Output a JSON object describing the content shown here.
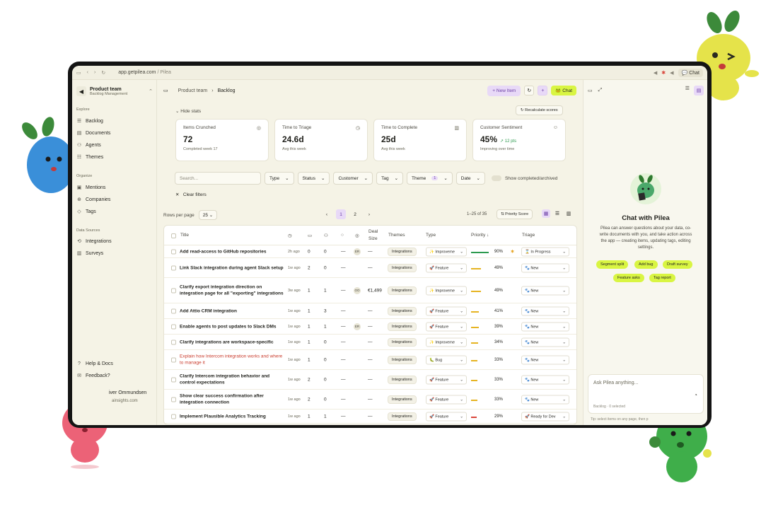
{
  "browser": {
    "url_domain": "app.getpilea.com",
    "url_suffix": " / Pilea",
    "chat_label": "Chat"
  },
  "sidebar": {
    "team_name": "Product team",
    "team_sub": "Backlog Management",
    "sections": {
      "explore": "Explore",
      "organize": "Organize",
      "data_sources": "Data Sources"
    },
    "explore_items": [
      {
        "label": "Backlog",
        "icon": "list-icon"
      },
      {
        "label": "Documents",
        "icon": "document-icon"
      },
      {
        "label": "Agents",
        "icon": "agent-icon"
      },
      {
        "label": "Themes",
        "icon": "themes-icon"
      }
    ],
    "organize_items": [
      {
        "label": "Mentions",
        "icon": "mentions-icon"
      },
      {
        "label": "Companies",
        "icon": "companies-icon"
      },
      {
        "label": "Tags",
        "icon": "tag-icon"
      }
    ],
    "data_items": [
      {
        "label": "Integrations",
        "icon": "integrations-icon"
      },
      {
        "label": "Surveys",
        "icon": "surveys-icon"
      }
    ],
    "help": "Help & Docs",
    "feedback": "Feedback?",
    "user_name": "iver Ommundsen",
    "user_email": "ainsights.com"
  },
  "topbar": {
    "crumb_root": "Product team",
    "crumb_sep": "›",
    "crumb_current": "Backlog",
    "new_item": "+ New Item",
    "chat": "Chat"
  },
  "stats_toggle": "Hide stats",
  "recalc": "Recalculate scores",
  "stats": [
    {
      "label": "Items Crunched",
      "value": "72",
      "sub": "Completed week 17",
      "icon": "target-icon"
    },
    {
      "label": "Time to Triage",
      "value": "24.6d",
      "sub": "Avg this week",
      "icon": "clock-icon"
    },
    {
      "label": "Time to Complete",
      "value": "25d",
      "sub": "Avg this week",
      "icon": "chart-icon"
    },
    {
      "label": "Customer Sentiment",
      "value": "45%",
      "delta": "↗ 12 pts",
      "sub": "Improving over time",
      "icon": "smile-icon"
    }
  ],
  "filters": {
    "search_placeholder": "Search...",
    "type": "Type",
    "status": "Status",
    "customer": "Customer",
    "tag": "Tag",
    "theme": "Theme",
    "theme_count": "1",
    "date": "Date",
    "show_completed": "Show completed/archived",
    "clear": "Clear filters"
  },
  "pagination": {
    "rows_label": "Rows per page",
    "rows_value": "25",
    "prev": "‹",
    "next": "›",
    "pages": [
      "1",
      "2"
    ],
    "range": "1–25 of 35",
    "sort": "Priority Score"
  },
  "table": {
    "headers": {
      "title": "Title",
      "deal": "Deal",
      "deal2": "Size",
      "themes": "Themes",
      "type": "Type",
      "priority": "Priority ↓",
      "triage": "Triage"
    },
    "rows": [
      {
        "title": "Add read-access to GitHub repositories",
        "red": false,
        "age": "2h ago",
        "c1": "0",
        "c2": "0",
        "c3": "—",
        "av": "ER",
        "deal": "—",
        "theme": "Integrations",
        "type": "✨ Improveme",
        "pct": 90,
        "pct_label": "90%",
        "color": "#2c9a4e",
        "triage": "⌛ In Progress",
        "star": true
      },
      {
        "title": "Link Slack integration during agent Slack setup",
        "red": false,
        "age": "1w ago",
        "c1": "2",
        "c2": "0",
        "c3": "—",
        "av": "",
        "deal": "—",
        "theme": "Integrations",
        "type": "🚀 Feature",
        "pct": 49,
        "pct_label": "49%",
        "color": "#e6b422",
        "triage": "🐾 New",
        "star": false
      },
      {
        "title": "Clarify export integration direction on integration page for all \"exporting\" integrations",
        "red": false,
        "age": "3w ago",
        "c1": "1",
        "c2": "1",
        "c3": "—",
        "av": "OO",
        "deal": "€1,499",
        "theme": "Integrations",
        "type": "✨ Improveme",
        "pct": 49,
        "pct_label": "49%",
        "color": "#e6b422",
        "triage": "🐾 New",
        "star": false
      },
      {
        "title": "Add Attio CRM integration",
        "red": false,
        "age": "1w ago",
        "c1": "1",
        "c2": "3",
        "c3": "—",
        "av": "",
        "deal": "—",
        "theme": "Integrations",
        "type": "🚀 Feature",
        "pct": 41,
        "pct_label": "41%",
        "color": "#e6b422",
        "triage": "🐾 New",
        "star": false
      },
      {
        "title": "Enable agents to post updates to Slack DMs",
        "red": false,
        "age": "1w ago",
        "c1": "1",
        "c2": "1",
        "c3": "—",
        "av": "ER",
        "deal": "—",
        "theme": "Integrations",
        "type": "🚀 Feature",
        "pct": 39,
        "pct_label": "39%",
        "color": "#e6b422",
        "triage": "🐾 New",
        "star": false
      },
      {
        "title": "Clarify integrations are workspace-specific",
        "red": false,
        "age": "1w ago",
        "c1": "1",
        "c2": "0",
        "c3": "—",
        "av": "",
        "deal": "—",
        "theme": "Integrations",
        "type": "✨ Improveme",
        "pct": 34,
        "pct_label": "34%",
        "color": "#e6b422",
        "triage": "🐾 New",
        "star": false
      },
      {
        "title": "Explain how Intercom integration works and where to manage it",
        "red": true,
        "age": "1w ago",
        "c1": "1",
        "c2": "0",
        "c3": "—",
        "av": "",
        "deal": "—",
        "theme": "Integrations",
        "type": "🐛 Bug",
        "pct": 33,
        "pct_label": "33%",
        "color": "#e6b422",
        "triage": "🐾 New",
        "star": false
      },
      {
        "title": "Clarify Intercom integration behavior and control expectations",
        "red": false,
        "age": "1w ago",
        "c1": "2",
        "c2": "0",
        "c3": "—",
        "av": "",
        "deal": "—",
        "theme": "Integrations",
        "type": "🚀 Feature",
        "pct": 33,
        "pct_label": "33%",
        "color": "#e6b422",
        "triage": "🐾 New",
        "star": false
      },
      {
        "title": "Show clear success confirmation after integration connection",
        "red": false,
        "age": "1w ago",
        "c1": "2",
        "c2": "0",
        "c3": "—",
        "av": "",
        "deal": "—",
        "theme": "Integrations",
        "type": "🚀 Feature",
        "pct": 33,
        "pct_label": "33%",
        "color": "#e6b422",
        "triage": "🐾 New",
        "star": false
      },
      {
        "title": "Implement Plausible Analytics Tracking",
        "red": false,
        "age": "1w ago",
        "c1": "1",
        "c2": "1",
        "c3": "—",
        "av": "",
        "deal": "—",
        "theme": "Integrations",
        "type": "🚀 Feature",
        "pct": 29,
        "pct_label": "29%",
        "color": "#d9453a",
        "triage": "🚀 Ready for Dev",
        "star": false
      }
    ]
  },
  "chat": {
    "title": "Chat with Pilea",
    "desc": "Pilea can answer questions about your data, co-write documents with you, and take action across the app — creating items, updating tags, editing settings.",
    "suggestions": [
      "Segment split",
      "Add bug",
      "Draft survey",
      "Feature asks",
      "Tag report"
    ],
    "placeholder": "Ask Pilea anything...",
    "context": "Backlog · 0 selected",
    "tip": "Tip: select items on any page, then p"
  },
  "colors": {
    "accent_purple": "#e8d9f7",
    "accent_lime": "#d9f542",
    "background": "#f5f3e6"
  }
}
